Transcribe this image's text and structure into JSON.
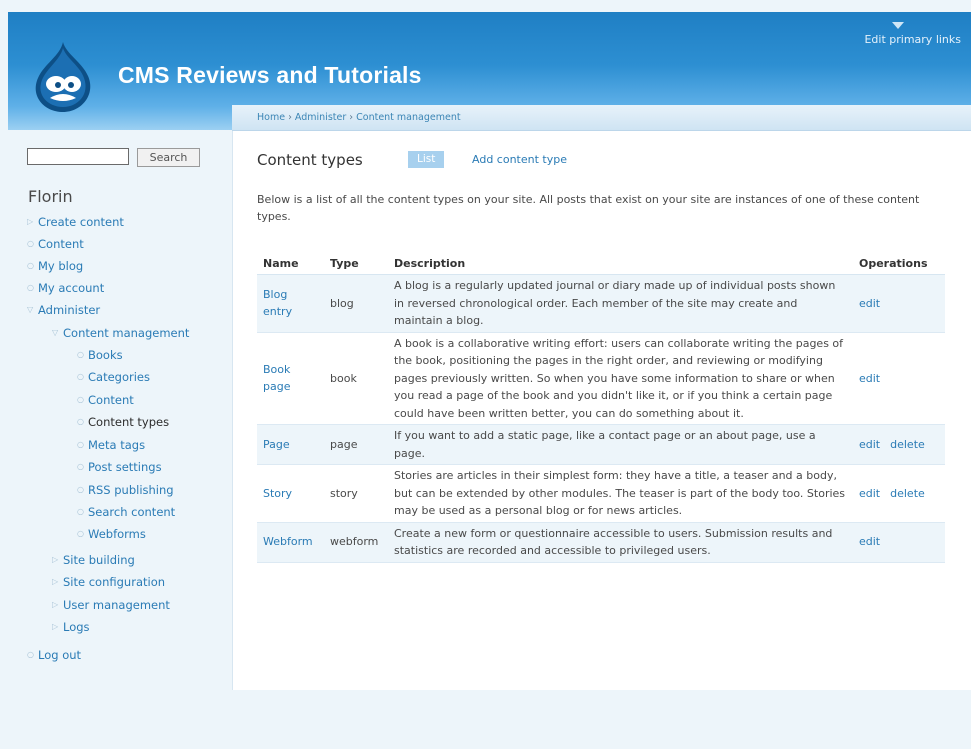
{
  "header": {
    "site_name": "CMS Reviews and Tutorials",
    "edit_primary_links": "Edit primary links",
    "logo": "drupal-drop-logo"
  },
  "breadcrumb": [
    "Home",
    "Administer",
    "Content management"
  ],
  "search": {
    "value": "",
    "button": "Search"
  },
  "sidebar": {
    "user": "Florin",
    "items": [
      {
        "label": "Create content",
        "icon": "triangle-right"
      },
      {
        "label": "Content",
        "icon": "circle"
      },
      {
        "label": "My blog",
        "icon": "circle"
      },
      {
        "label": "My account",
        "icon": "circle"
      },
      {
        "label": "Administer",
        "icon": "triangle-down"
      },
      {
        "label": "Content management",
        "icon": "triangle-down"
      },
      {
        "label": "Books",
        "icon": "circle"
      },
      {
        "label": "Categories",
        "icon": "circle"
      },
      {
        "label": "Content",
        "icon": "circle"
      },
      {
        "label": "Content types",
        "icon": "circle"
      },
      {
        "label": "Meta tags",
        "icon": "circle"
      },
      {
        "label": "Post settings",
        "icon": "circle"
      },
      {
        "label": "RSS publishing",
        "icon": "circle"
      },
      {
        "label": "Search content",
        "icon": "circle"
      },
      {
        "label": "Webforms",
        "icon": "circle"
      },
      {
        "label": "Site building",
        "icon": "triangle-right"
      },
      {
        "label": "Site configuration",
        "icon": "triangle-right"
      },
      {
        "label": "User management",
        "icon": "triangle-right"
      },
      {
        "label": "Logs",
        "icon": "triangle-right"
      },
      {
        "label": "Log out",
        "icon": "circle"
      }
    ]
  },
  "main": {
    "title": "Content types",
    "tabs": {
      "list": "List",
      "add": "Add content type"
    },
    "intro": "Below is a list of all the content types on your site. All posts that exist on your site are instances of one of these content types.",
    "columns": {
      "name": "Name",
      "type": "Type",
      "description": "Description",
      "operations": "Operations"
    },
    "rows": [
      {
        "name": "Blog entry",
        "type": "blog",
        "description": "A blog is a regularly updated journal or diary made up of individual posts shown in reversed chronological order. Each member of the site may create and maintain a blog.",
        "edit": "edit",
        "delete": ""
      },
      {
        "name": "Book page",
        "type": "book",
        "description": "A book is a collaborative writing effort: users can collaborate writing the pages of the book, positioning the pages in the right order, and reviewing or modifying pages previously written. So when you have some information to share or when you read a page of the book and you didn't like it, or if you think a certain page could have been written better, you can do something about it.",
        "edit": "edit",
        "delete": ""
      },
      {
        "name": "Page",
        "type": "page",
        "description": "If you want to add a static page, like a contact page or an about page, use a page.",
        "edit": "edit",
        "delete": "delete"
      },
      {
        "name": "Story",
        "type": "story",
        "description": "Stories are articles in their simplest form: they have a title, a teaser and a body, but can be extended by other modules. The teaser is part of the body too. Stories may be used as a personal blog or for news articles.",
        "edit": "edit",
        "delete": "delete"
      },
      {
        "name": "Webform",
        "type": "webform",
        "description": "Create a new form or questionnaire accessible to users. Submission results and statistics are recorded and accessible to privileged users.",
        "edit": "edit",
        "delete": ""
      }
    ]
  },
  "colors": {
    "link": "#2a7bb5",
    "header_top": "#1f7fc4",
    "tab_active": "#a7d0ee",
    "odd_row": "#edf5fa"
  }
}
